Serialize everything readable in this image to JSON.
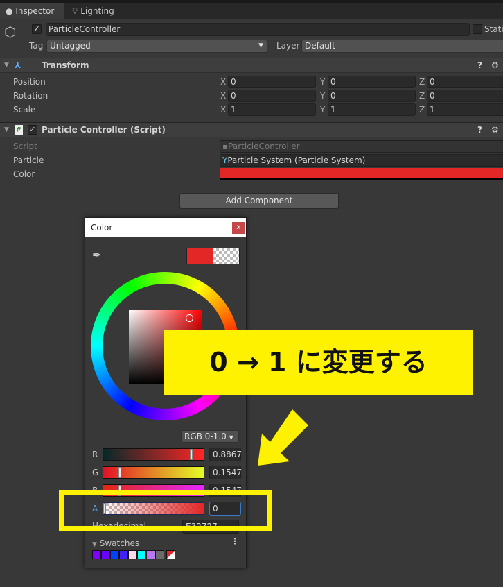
{
  "tabs": [
    {
      "label": "Inspector",
      "icon": "info-icon"
    },
    {
      "label": "Lighting",
      "icon": "lightbulb-icon"
    }
  ],
  "object": {
    "name": "ParticleController",
    "active": true,
    "static_label": "Static",
    "tag_label": "Tag",
    "tag_value": "Untagged",
    "layer_label": "Layer",
    "layer_value": "Default"
  },
  "transform": {
    "title": "Transform",
    "rows": [
      {
        "label": "Position",
        "x": "0",
        "y": "0",
        "z": "0"
      },
      {
        "label": "Rotation",
        "x": "0",
        "y": "0",
        "z": "0"
      },
      {
        "label": "Scale",
        "x": "1",
        "y": "1",
        "z": "1"
      }
    ],
    "axes": [
      "X",
      "Y",
      "Z"
    ]
  },
  "script_component": {
    "title": "Particle Controller (Script)",
    "enabled": true,
    "rows": [
      {
        "label": "Script",
        "value": "ParticleController"
      },
      {
        "label": "Particle",
        "value": "Particle System (Particle System)"
      },
      {
        "label": "Color",
        "value": ""
      }
    ],
    "color_value": "#e32727"
  },
  "add_component_label": "Add Component",
  "color_picker": {
    "title": "Color",
    "close": "x",
    "mode": "RGB 0-1.0",
    "channels": [
      {
        "label": "R",
        "value": "0.8867",
        "fraction": 0.8867
      },
      {
        "label": "G",
        "value": "0.1547",
        "fraction": 0.1547
      },
      {
        "label": "B",
        "value": "0.1547",
        "fraction": 0.1547
      },
      {
        "label": "A",
        "value": "0",
        "fraction": 0
      }
    ],
    "hex_label": "Hexadecimal",
    "hex_value": "E32727",
    "swatches_label": "Swatches",
    "swatches": [
      "#8000ff",
      "#6a00ff",
      "#0040ff",
      "#4020ff",
      "#ffd8e8",
      "#00ffff",
      "#b878f0",
      "#6a6a6a"
    ]
  },
  "annotation": {
    "text": "0 → 1 に変更する",
    "color": "#fff200"
  }
}
